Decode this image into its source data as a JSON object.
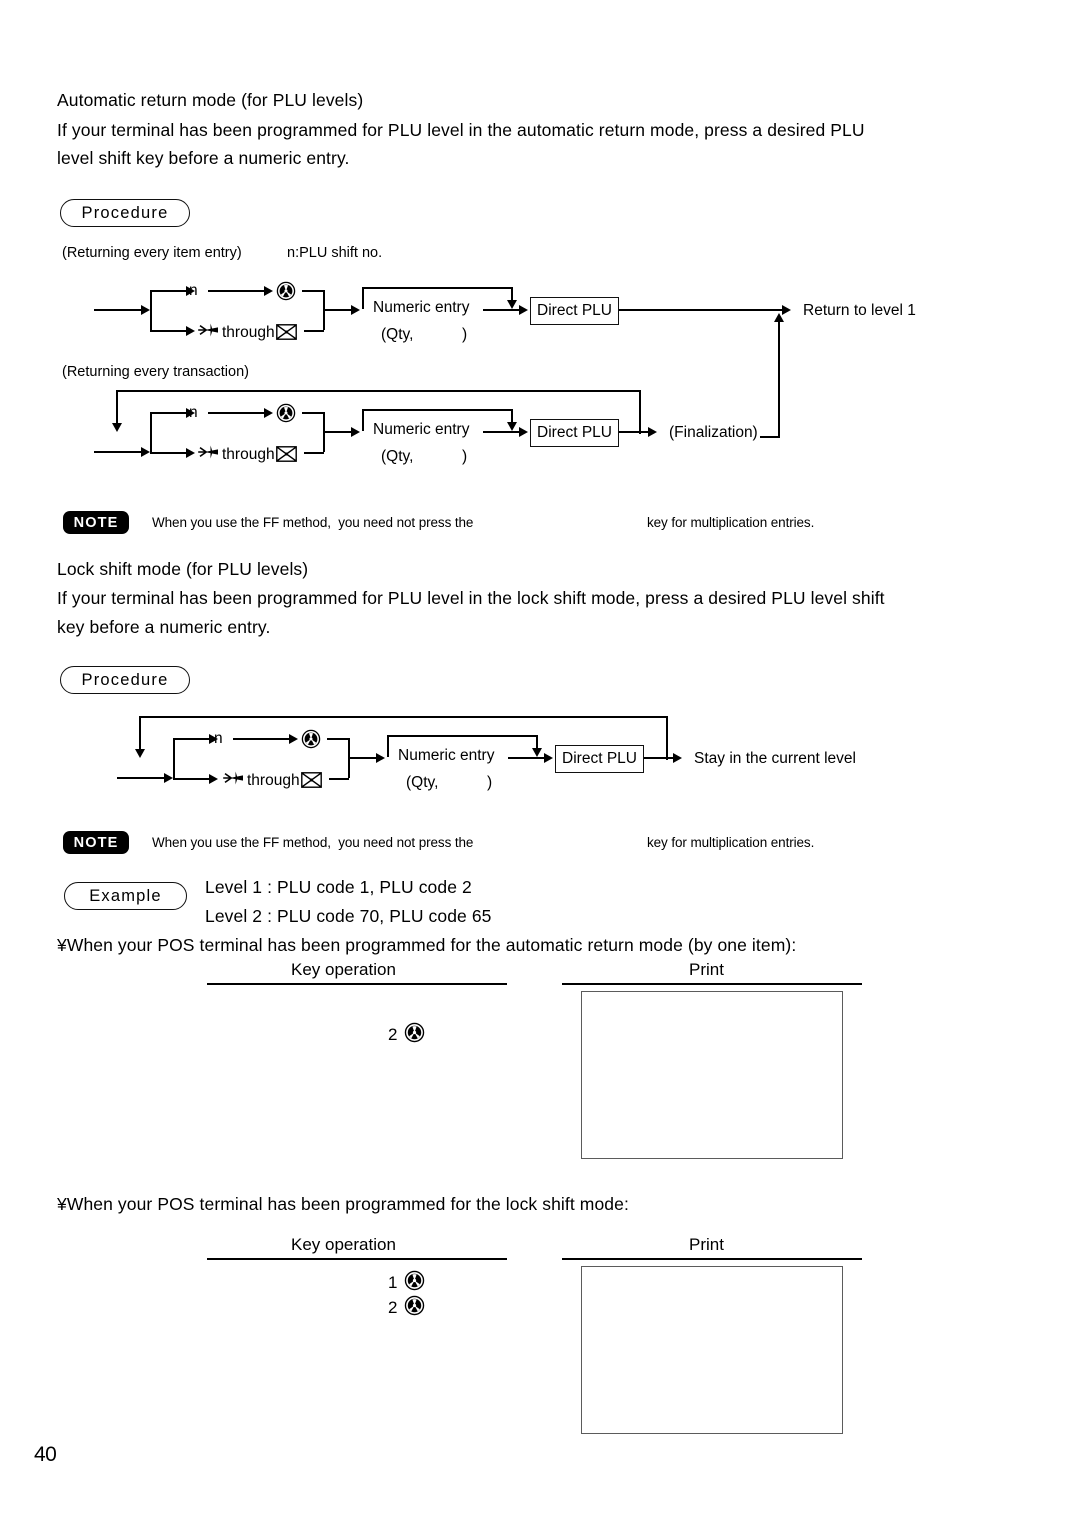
{
  "page": {
    "number": "40"
  },
  "section_auto": {
    "heading": "Automatic return mode (for PLU levels)",
    "paragraph_line1": "If your terminal has been programmed for PLU level in the automatic return mode, press a desired PLU",
    "paragraph_line2": "level shift key before a numeric entry.",
    "procedure_label": "Procedure",
    "caption_item": "(Returning every item entry)",
    "caption_legend": "n:PLU shift no.",
    "caption_transaction": "(Returning every transaction)"
  },
  "flow_auto_item": {
    "n_label": "n",
    "through_label": "through",
    "numeric_entry": "Numeric entry",
    "qty_label": "(Qty,",
    "qty_close": ")",
    "direct_plu": "Direct PLU",
    "terminal": "Return to level 1"
  },
  "flow_auto_transaction": {
    "n_label": "n",
    "through_label": "through",
    "numeric_entry": "Numeric entry",
    "qty_label": "(Qty,",
    "qty_close": ")",
    "direct_plu": "Direct PLU",
    "finalization": "(Finalization)"
  },
  "note1": {
    "badge": "NOTE",
    "text_before": "When you use the FF method,  you need not press the",
    "text_after": "key for multiplication entries."
  },
  "section_lock": {
    "heading": "Lock shift mode (for PLU levels)",
    "paragraph_line1": "If your terminal has been programmed for PLU level in the lock shift mode, press a desired PLU level shift",
    "paragraph_line2": "key before a numeric entry.",
    "procedure_label": "Procedure"
  },
  "flow_lock": {
    "n_label": "n",
    "through_label": "through",
    "numeric_entry": "Numeric entry",
    "qty_label": "(Qty,",
    "qty_close": ")",
    "direct_plu": "Direct PLU",
    "terminal": "Stay in the current level"
  },
  "note2": {
    "badge": "NOTE",
    "text_before": "When you use the FF method,  you need not press the",
    "text_after": "key for multiplication entries."
  },
  "example": {
    "label": "Example",
    "line1": "Level 1 : PLU code 1, PLU code 2",
    "line2": "Level 2 : PLU code 70, PLU code 65"
  },
  "case_auto": {
    "intro": "¥When your POS terminal has been programmed for the automatic return mode (by one item):",
    "col_key": "Key operation",
    "col_print": "Print",
    "keys": [
      {
        "digit": "2",
        "icon": "plu-level-shift-icon"
      }
    ]
  },
  "case_lock": {
    "intro": "¥When your POS terminal has been programmed for the lock shift mode:",
    "col_key": "Key operation",
    "col_print": "Print",
    "keys": [
      {
        "digit": "1",
        "icon": "plu-level-shift-icon"
      },
      {
        "digit": "2",
        "icon": "plu-level-shift-icon"
      }
    ]
  },
  "icons": {
    "plu_level_shift": "plu-level-shift-icon",
    "arrow_key": "arrow-key-icon",
    "boxed_x": "boxed-x-icon"
  }
}
